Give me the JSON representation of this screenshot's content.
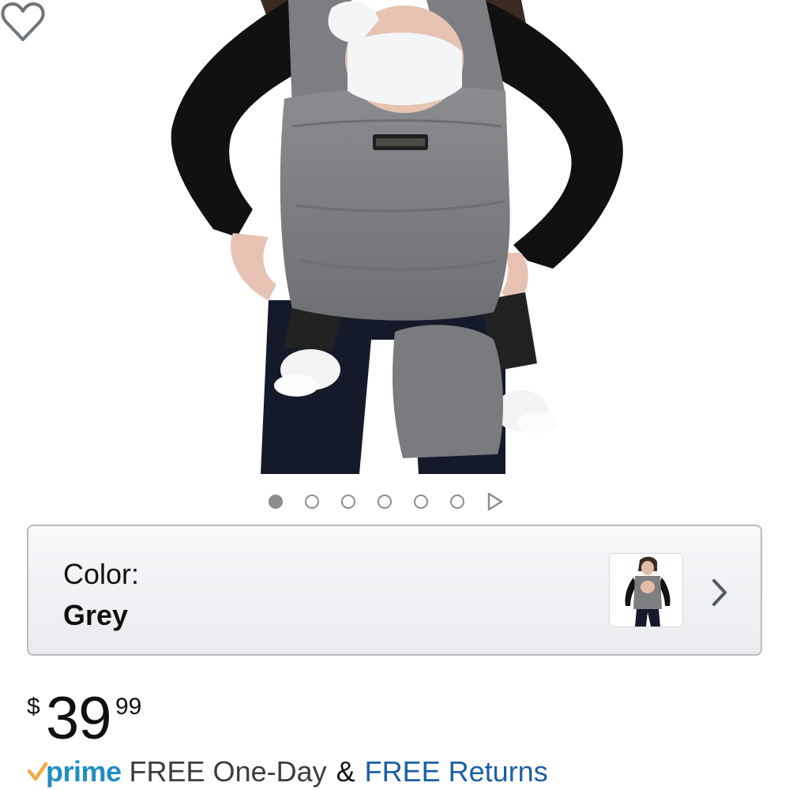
{
  "product_image": {
    "description_icon": "baby-carrier-photo",
    "wishlist_icon": "heart-outline-icon"
  },
  "carousel": {
    "slides": 6,
    "active_index": 0,
    "next_icon": "play-triangle-icon"
  },
  "color_selector": {
    "label": "Color:",
    "value": "Grey",
    "thumbnail_icon": "grey-wrap-thumbnail",
    "chevron_icon": "chevron-right-icon"
  },
  "price": {
    "currency": "$",
    "whole": "39",
    "fraction": "99"
  },
  "shipping": {
    "prime_label": "prime",
    "delivery_text": "FREE One-Day",
    "ampersand": "&",
    "returns_link": "FREE Returns"
  },
  "colors": {
    "prime_blue": "#1f8fc1",
    "prime_check": "#f3a847",
    "link_blue": "#1a5fa6",
    "wrap_grey": "#8a8b8d"
  }
}
